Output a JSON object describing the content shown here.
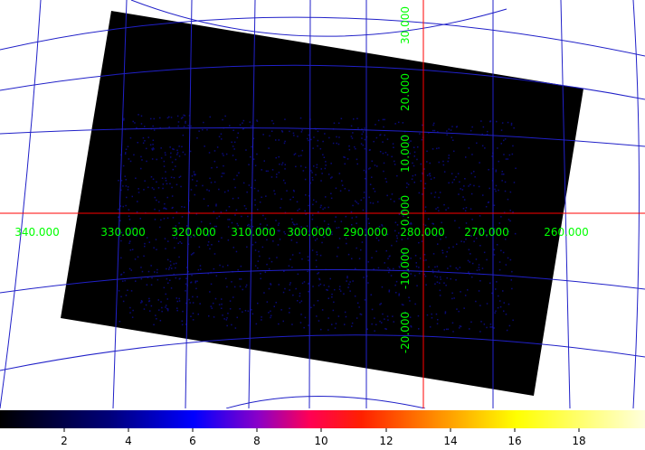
{
  "colors": {
    "background": "#ffffff",
    "image_fill": "#000000",
    "noise": "#0a0a78",
    "grid_line": "#2020c8",
    "crosshair": "#ff0000",
    "label_text": "#00ff00"
  },
  "axes": {
    "ra_labels": [
      "340.000",
      "330.000",
      "320.000",
      "310.000",
      "300.000",
      "290.000",
      "280.000",
      "270.000",
      "260.000"
    ],
    "dec_labels": [
      "30.000",
      "20.000",
      "10.000",
      "0.000",
      "-10.000",
      "-20.000"
    ]
  },
  "colorbar": {
    "colormap": "heat",
    "ticks": [
      "2",
      "4",
      "6",
      "8",
      "10",
      "12",
      "14",
      "16",
      "18"
    ]
  }
}
